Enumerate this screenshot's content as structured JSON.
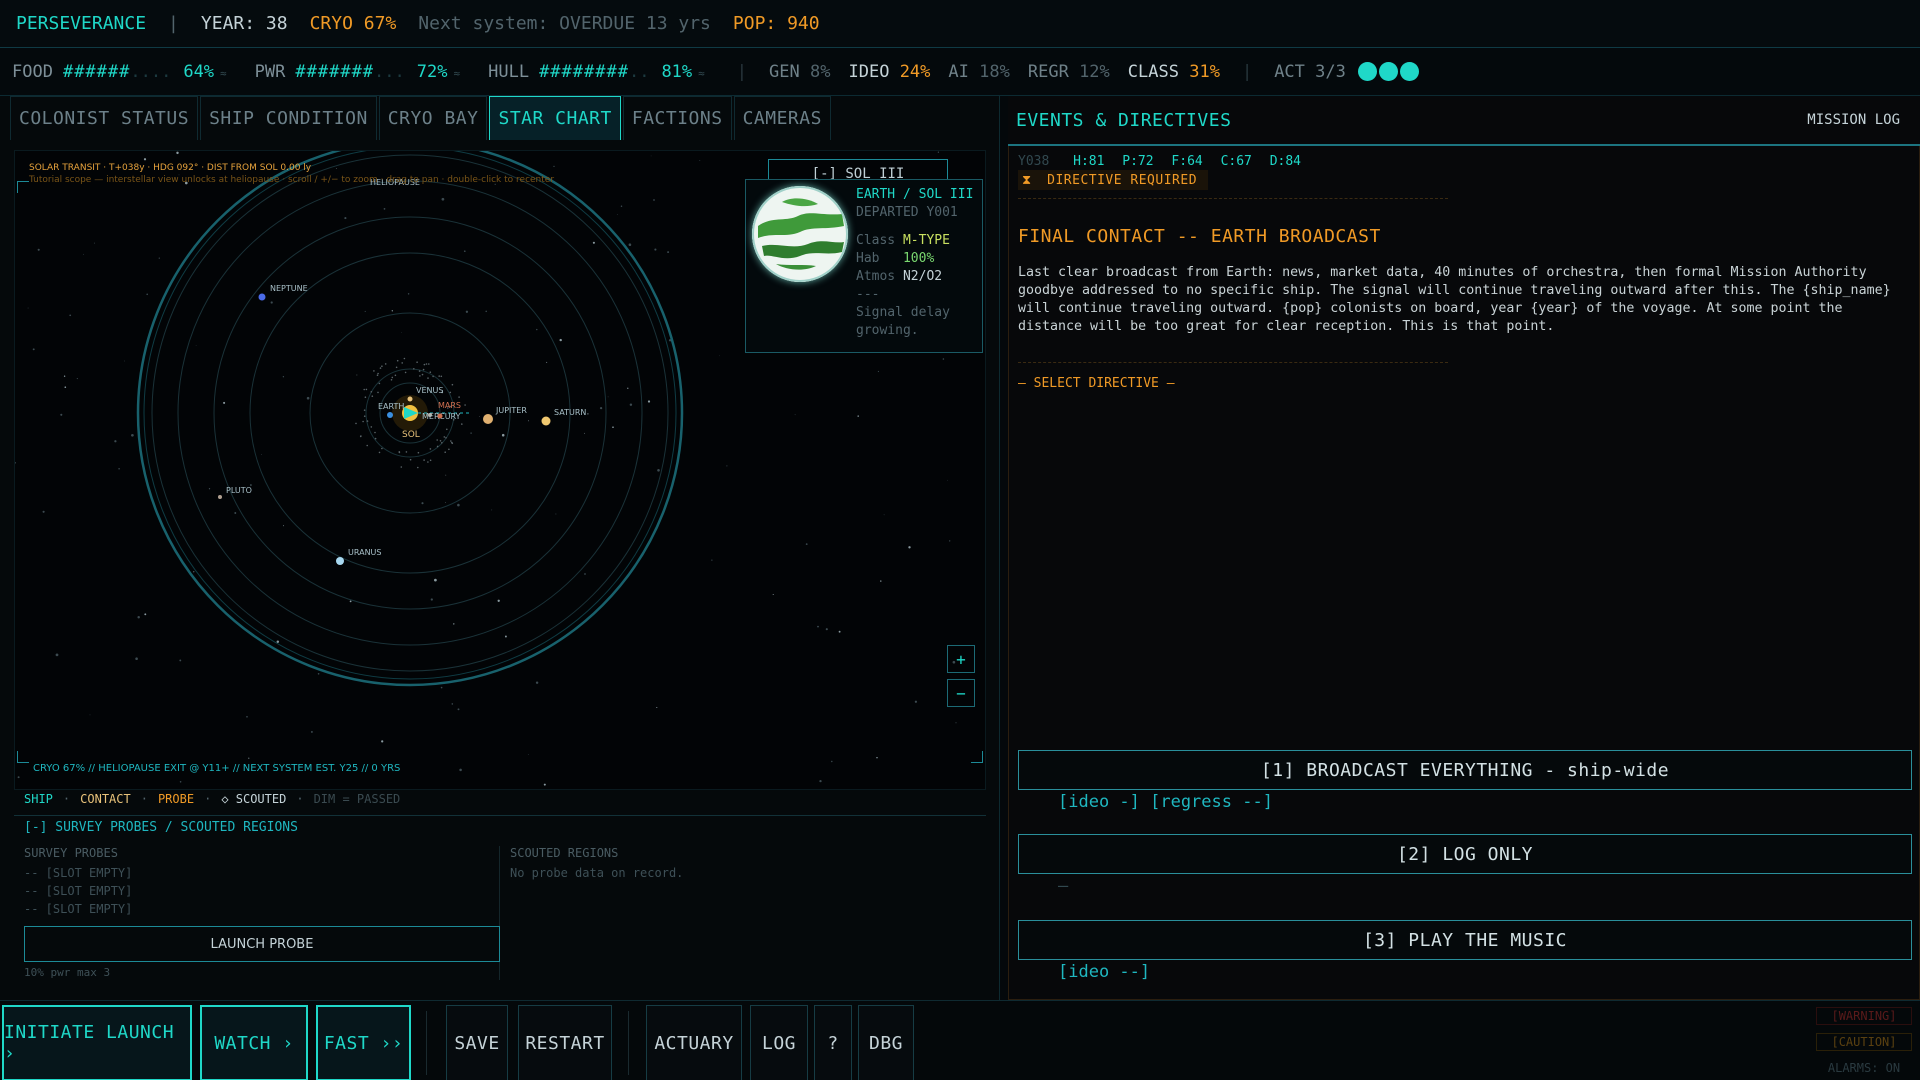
{
  "topbar": {
    "ship_name": "PERSEVERANCE",
    "divider": "|",
    "year": "YEAR: 38",
    "cryo": "CRYO 67%",
    "next_system": "Next system: OVERDUE 13 yrs",
    "pop": "POP: 940"
  },
  "resources": [
    {
      "label": "FOOD",
      "bar": "######",
      "empty": "....",
      "pct": "64%",
      "trend": "≈"
    },
    {
      "label": "PWR",
      "bar": "#######",
      "empty": "...",
      "pct": "72%",
      "trend": "≈"
    },
    {
      "label": "HULL",
      "bar": "########",
      "empty": "..",
      "pct": "81%",
      "trend": "≈"
    }
  ],
  "stats": {
    "gen_label": "GEN",
    "gen_value": "8%",
    "ideo_label": "IDEO",
    "ideo_value": "24%",
    "ai_label": "AI",
    "ai_value": "18%",
    "regr_label": "REGR",
    "regr_value": "12%",
    "class_label": "CLASS",
    "class_value": "31%",
    "act": "ACT 3/3"
  },
  "tabs": [
    "COLONIST STATUS",
    "SHIP CONDITION",
    "CRYO BAY",
    "STAR CHART",
    "FACTIONS",
    "CAMERAS"
  ],
  "active_tab": "STAR CHART",
  "chart": {
    "hud_top": "SOLAR TRANSIT  ·  T+038y  ·  HDG 092°  ·  DIST FROM SOL 0.00 ly",
    "hud_tutorial": "Tutorial scope — interstellar view unlocks at heliopause  ·  scroll / +/− to zoom  ·  drag to pan  ·  double-click to recenter",
    "hud_bottom": "CRYO 67%  //  HELIOPAUSE EXIT @ Y11+  //  NEXT SYSTEM EST. Y25  //  0 YRS",
    "heliopause_label": "HELIOPAUSE",
    "sun_label": "SOL",
    "bodies": [
      {
        "name": "MERCURY",
        "color": "#b8b0a0"
      },
      {
        "name": "VENUS",
        "color": "#e8c27a"
      },
      {
        "name": "EARTH",
        "color": "#3a8fe0"
      },
      {
        "name": "MARS",
        "color": "#d07050"
      },
      {
        "name": "JUPITER",
        "color": "#e0b070"
      },
      {
        "name": "SATURN",
        "color": "#f0c870"
      },
      {
        "name": "URANUS",
        "color": "#a8d8f0"
      },
      {
        "name": "NEPTUNE",
        "color": "#4a6ae8"
      },
      {
        "name": "PLUTO",
        "color": "#b0a090"
      }
    ],
    "zoom_in": "+",
    "zoom_out": "−"
  },
  "detail": {
    "header": "[-]  SOL III",
    "name": "EARTH / SOL III",
    "departed": "DEPARTED Y001",
    "class_label": "Class",
    "class_value": "M-TYPE",
    "hab_label": "Hab",
    "hab_value": "100%",
    "atmos_label": "Atmos",
    "atmos_value": "N2/O2",
    "divider": "---",
    "note_1": "Signal delay",
    "note_2": "growing."
  },
  "legend": {
    "ship": "SHIP",
    "sep": "·",
    "contact": "CONTACT",
    "probe": "PROBE",
    "scouted": "◇ SCOUTED",
    "passed": "DIM = PASSED"
  },
  "survey": {
    "header": "[-] SURVEY PROBES   /   SCOUTED REGIONS",
    "probes_title": "SURVEY PROBES",
    "slots": [
      "--  [SLOT EMPTY]",
      "--  [SLOT EMPTY]",
      "--  [SLOT EMPTY]"
    ],
    "launch_label": "LAUNCH PROBE",
    "footnote": "10% pwr  max 3",
    "regions_title": "SCOUTED REGIONS",
    "regions_empty": "No probe data on record."
  },
  "events": {
    "header": "EVENTS & DIRECTIVES",
    "mission_log": "MISSION LOG",
    "year": "Y038",
    "stats": [
      "H:81",
      "P:72",
      "F:64",
      "C:67",
      "D:84"
    ],
    "required": "DIRECTIVE REQUIRED",
    "title": "FINAL CONTACT -- EARTH BROADCAST",
    "body": "Last clear broadcast from Earth: news, market data, 40 minutes of orchestra, then formal Mission Authority goodbye addressed to no specific ship. The signal will continue traveling outward after this. The {ship_name} will continue traveling outward. {pop} colonists on board, year {year} of the voyage. At some point the distance will be too great for clear reception. This is that point.",
    "select_label": "— SELECT DIRECTIVE —",
    "options": [
      {
        "label": "[1]  BROADCAST EVERYTHING - ship-wide",
        "effects": "[ideo -]  [regress --]"
      },
      {
        "label": "[2]  LOG ONLY",
        "effects": "—"
      },
      {
        "label": "[3]  PLAY THE MUSIC",
        "effects": "[ideo --]"
      }
    ]
  },
  "bottom": {
    "initiate_launch": "INITIATE LAUNCH ›",
    "watch": "WATCH ›",
    "fast": "FAST ››",
    "save": "SAVE",
    "restart": "RESTART",
    "actuary": "ACTUARY",
    "log": "LOG",
    "help": "?",
    "dbg": "DBG",
    "alarm_warning": "[WARNING]",
    "alarm_caution": "[CAUTION]",
    "alarms_on": "ALARMS: ON"
  },
  "colors": {
    "accent": "#1fd8c8",
    "warning": "#f09a26",
    "panel": "#05090b"
  }
}
